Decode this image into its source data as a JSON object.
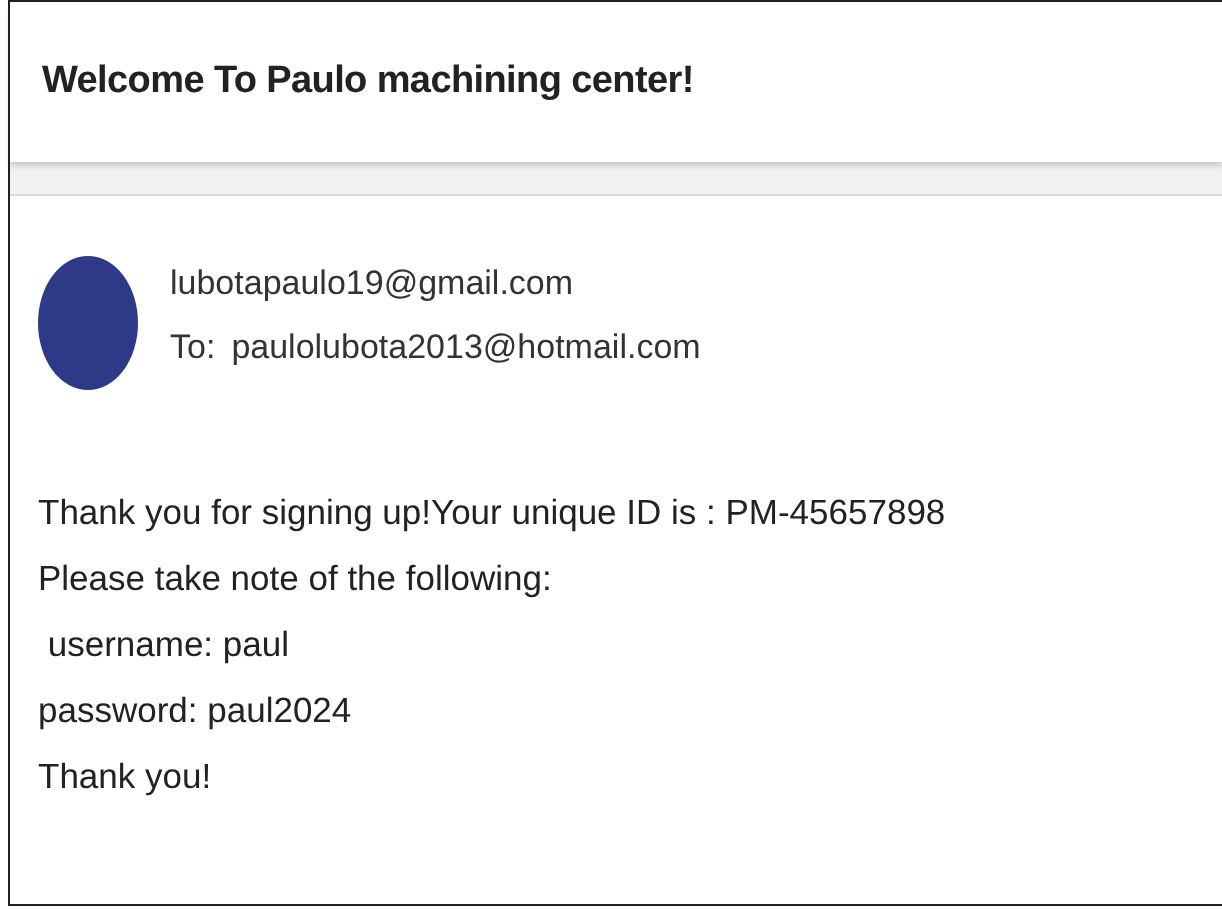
{
  "header": {
    "title": "Welcome To Paulo machining center!"
  },
  "message": {
    "sender": "lubotapaulo19@gmail.com",
    "recipient_label": "To:",
    "recipient": "paulolubota2013@hotmail.com",
    "body": [
      "Thank you for signing up!Your unique ID is : PM-45657898",
      "Please take note of the following:",
      " username: paul",
      "password: paul2024",
      "Thank you!"
    ]
  }
}
